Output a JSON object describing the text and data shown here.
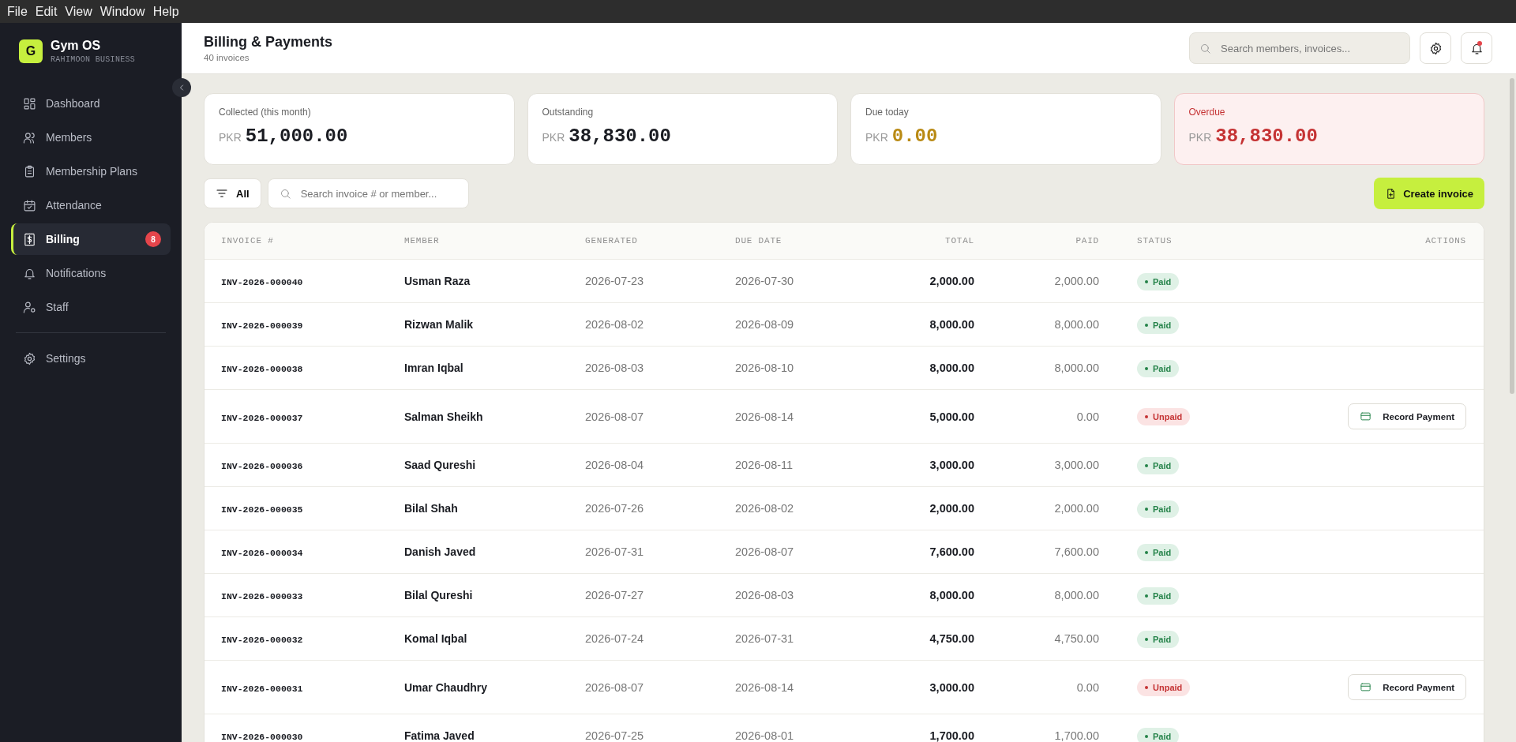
{
  "menu_bar": [
    "File",
    "Edit",
    "View",
    "Window",
    "Help"
  ],
  "sidebar": {
    "logo_letter": "G",
    "app_name": "Gym OS",
    "business": "RAHIMOON BUSINESS",
    "items": [
      {
        "label": "Dashboard",
        "selected": false
      },
      {
        "label": "Members",
        "selected": false
      },
      {
        "label": "Membership Plans",
        "selected": false
      },
      {
        "label": "Attendance",
        "selected": false
      },
      {
        "label": "Billing",
        "selected": true,
        "badge": "8"
      },
      {
        "label": "Notifications",
        "selected": false
      },
      {
        "label": "Staff",
        "selected": false
      }
    ],
    "footer_items": [
      {
        "label": "Settings",
        "selected": false
      }
    ]
  },
  "header": {
    "title": "Billing & Payments",
    "subtitle": "40 invoices",
    "search": {
      "placeholder": "Search members, invoices..."
    },
    "notification_dot": true
  },
  "cards": [
    {
      "label": "Collected (this month)",
      "currency": "PKR",
      "value": "51,000.00",
      "kind": "normal"
    },
    {
      "label": "Outstanding",
      "currency": "PKR",
      "value": "38,830.00",
      "kind": "normal"
    },
    {
      "label": "Due today",
      "currency": "PKR",
      "value": "0.00",
      "kind": "warning"
    },
    {
      "label": "Overdue",
      "currency": "PKR",
      "value": "38,830.00",
      "kind": "danger"
    }
  ],
  "filter": {
    "label": "All",
    "search_placeholder": "Search invoice # or member...",
    "create_button": "Create invoice"
  },
  "table": {
    "columns": [
      "INVOICE #",
      "MEMBER",
      "GENERATED",
      "DUE DATE",
      "TOTAL",
      "PAID",
      "STATUS",
      "ACTIONS"
    ],
    "rows": [
      {
        "invoice": "INV-2026-000040",
        "member": "Usman Raza",
        "generated": "2026-07-23",
        "due": "2026-07-30",
        "total": "2,000.00",
        "paid": "2,000.00",
        "status": "Paid",
        "kind": "paid"
      },
      {
        "invoice": "INV-2026-000039",
        "member": "Rizwan Malik",
        "generated": "2026-08-02",
        "due": "2026-08-09",
        "total": "8,000.00",
        "paid": "8,000.00",
        "status": "Paid",
        "kind": "paid"
      },
      {
        "invoice": "INV-2026-000038",
        "member": "Imran Iqbal",
        "generated": "2026-08-03",
        "due": "2026-08-10",
        "total": "8,000.00",
        "paid": "8,000.00",
        "status": "Paid",
        "kind": "paid"
      },
      {
        "invoice": "INV-2026-000037",
        "member": "Salman Sheikh",
        "generated": "2026-08-07",
        "due": "2026-08-14",
        "total": "5,000.00",
        "paid": "0.00",
        "status": "Unpaid",
        "kind": "unpaid",
        "action": "Record Payment"
      },
      {
        "invoice": "INV-2026-000036",
        "member": "Saad Qureshi",
        "generated": "2026-08-04",
        "due": "2026-08-11",
        "total": "3,000.00",
        "paid": "3,000.00",
        "status": "Paid",
        "kind": "paid"
      },
      {
        "invoice": "INV-2026-000035",
        "member": "Bilal Shah",
        "generated": "2026-07-26",
        "due": "2026-08-02",
        "total": "2,000.00",
        "paid": "2,000.00",
        "status": "Paid",
        "kind": "paid"
      },
      {
        "invoice": "INV-2026-000034",
        "member": "Danish Javed",
        "generated": "2026-07-31",
        "due": "2026-08-07",
        "total": "7,600.00",
        "paid": "7,600.00",
        "status": "Paid",
        "kind": "paid"
      },
      {
        "invoice": "INV-2026-000033",
        "member": "Bilal Qureshi",
        "generated": "2026-07-27",
        "due": "2026-08-03",
        "total": "8,000.00",
        "paid": "8,000.00",
        "status": "Paid",
        "kind": "paid"
      },
      {
        "invoice": "INV-2026-000032",
        "member": "Komal Iqbal",
        "generated": "2026-07-24",
        "due": "2026-07-31",
        "total": "4,750.00",
        "paid": "4,750.00",
        "status": "Paid",
        "kind": "paid"
      },
      {
        "invoice": "INV-2026-000031",
        "member": "Umar Chaudhry",
        "generated": "2026-08-07",
        "due": "2026-08-14",
        "total": "3,000.00",
        "paid": "0.00",
        "status": "Unpaid",
        "kind": "unpaid",
        "action": "Record Payment"
      },
      {
        "invoice": "INV-2026-000030",
        "member": "Fatima Javed",
        "generated": "2026-07-25",
        "due": "2026-08-01",
        "total": "1,700.00",
        "paid": "1,700.00",
        "status": "Paid",
        "kind": "paid"
      }
    ]
  }
}
